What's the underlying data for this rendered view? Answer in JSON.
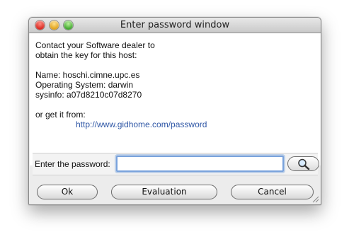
{
  "window": {
    "title": "Enter password window"
  },
  "message": {
    "line1": "Contact your Software dealer to",
    "line2": "obtain the key for this host:",
    "name": "Name: hoschi.cimne.upc.es",
    "os": "Operating System: darwin",
    "sysinfo": "sysinfo: a07d8210c07d8270",
    "alt": "or get it from:",
    "link": "http://www.gidhome.com/password"
  },
  "password": {
    "label": "Enter the password:",
    "value": ""
  },
  "buttons": {
    "ok": "Ok",
    "evaluation": "Evaluation",
    "cancel": "Cancel"
  },
  "colors": {
    "link": "#2f57a6",
    "focus_ring": "#7aa3dc"
  },
  "icons": {
    "search": "magnifier-icon"
  }
}
